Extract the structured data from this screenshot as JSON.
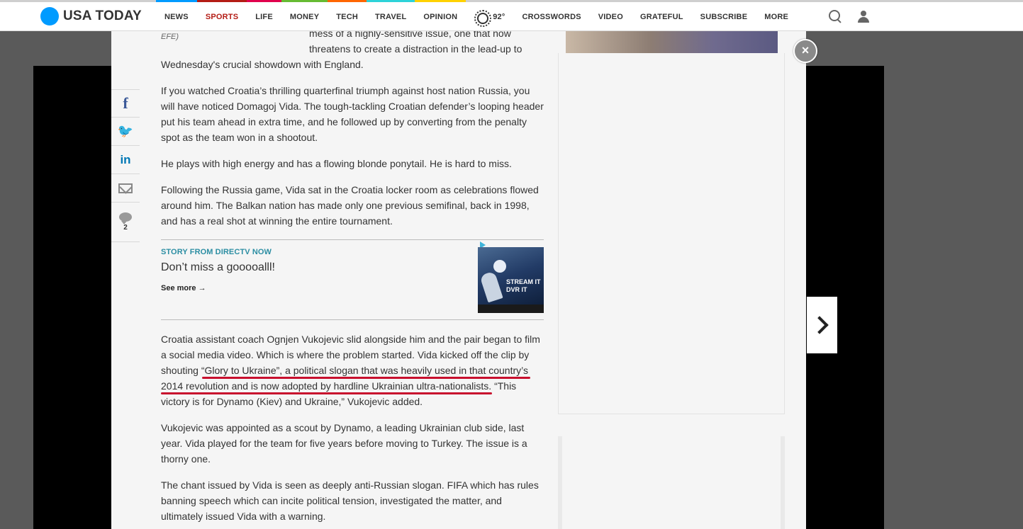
{
  "header": {
    "logo": "USA TODAY",
    "nav": [
      {
        "label": "NEWS",
        "color": "#009bff"
      },
      {
        "label": "SPORTS",
        "color": "#b41c15",
        "active": true
      },
      {
        "label": "LIFE",
        "color": "#e0004d"
      },
      {
        "label": "MONEY",
        "color": "#66bb33"
      },
      {
        "label": "TECH",
        "color": "#ff6600"
      },
      {
        "label": "TRAVEL",
        "color": "#2dd3d9"
      },
      {
        "label": "OPINION",
        "color": "#ffd200"
      }
    ],
    "weather": "92°",
    "nav2": [
      "CROSSWORDS",
      "VIDEO",
      "GRATEFUL",
      "SUBSCRIBE",
      "MORE"
    ]
  },
  "share": {
    "comment_count": "2"
  },
  "article": {
    "caption_source": "EFE)",
    "intro_line1": "mess of a highly-sensitive issue, one that now",
    "intro_line2": "threatens to create a distraction in the lead-up to",
    "intro_line3": "Wednesday's crucial showdown with England.",
    "p1": "If you watched Croatia’s thrilling quarterfinal triumph against host nation Russia, you will have noticed Domagoj Vida. The tough-tackling Croatian defender’s looping header put his team ahead in extra time, and he followed up by converting from the penalty spot as the team won in a shootout.",
    "p2": "He plays with high energy and has a flowing blonde ponytail. He is hard to miss.",
    "p3": "Following the Russia game, Vida sat in the Croatia locker room as celebrations flowed around him. The Balkan nation has made only one previous semifinal, back in 1998, and has a real shot at winning the entire tournament.",
    "p4": "Croatia assistant coach Ognjen Vukojevic slid alongside him and the pair began to film a social media video. Which is where the problem started. Vida kicked off the clip by shouting “Glory to Ukraine”, a political slogan that was heavily used in that country’s 2014 revolution and is now adopted by hardline Ukrainian ultra-nationalists. “This victory is for Dynamo (Kiev) and Ukraine,” Vukojevic added.",
    "p5": "Vukojevic was appointed as a scout by Dynamo, a leading Ukrainian club side, last year. Vida played for the team for five years before moving to Turkey. The issue is a thorny one.",
    "p6": "The chant issued by Vida is seen as deeply anti-Russian slogan. FIFA which has rules banning speech which can incite political tension, investigated the matter, and ultimately issued Vida with a warning."
  },
  "promo": {
    "label": "STORY FROM DIRECTV NOW",
    "title": "Don’t miss a gooooalll!",
    "link": "See more →",
    "img_text1": "STREAM IT",
    "img_text2": "DVR IT"
  },
  "controls": {
    "close": "×"
  }
}
